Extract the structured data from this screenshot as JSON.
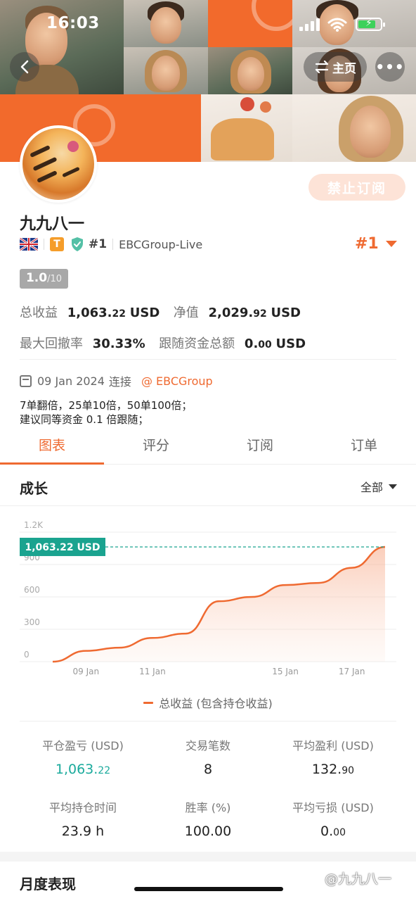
{
  "status_bar": {
    "time": "16:03"
  },
  "nav": {
    "home_label": "主页",
    "more_label": "•••"
  },
  "profile": {
    "name": "九九八一",
    "subscribe_label": "禁止订阅",
    "badge_letter": "T",
    "rank_small": "#1",
    "broker": "EBCGroup-Live",
    "rank_big": "#1",
    "score_main": "1.0",
    "score_total": "/10"
  },
  "metrics": {
    "total_profit_label": "总收益",
    "total_profit_int": "1,063.",
    "total_profit_dec": "22",
    "total_profit_cur": "USD",
    "equity_label": "净值",
    "equity_int": "2,029.",
    "equity_dec": "92",
    "equity_cur": "USD",
    "drawdown_label": "最大回撤率",
    "drawdown_value": "30.33%",
    "follow_label": "跟随资金总额",
    "follow_int": "0.",
    "follow_dec": "00",
    "follow_cur": "USD"
  },
  "join": {
    "date": "09 Jan 2024",
    "connect_label": "连接",
    "broker_link": "@ EBCGroup"
  },
  "description": {
    "line1": "7单翻倍，25单10倍，50单100倍；",
    "line2": "建议同等资金 0.1 倍跟随；"
  },
  "tabs": [
    "图表",
    "评分",
    "订阅",
    "订单"
  ],
  "growth": {
    "title": "成长",
    "range": "全部"
  },
  "chart_data": {
    "type": "area",
    "title": "",
    "x": [
      "08 Jan",
      "09 Jan",
      "10 Jan",
      "11 Jan",
      "12 Jan",
      "13 Jan",
      "14 Jan",
      "15 Jan",
      "16 Jan",
      "17 Jan",
      "18 Jan"
    ],
    "x_tick_labels": [
      "09 Jan",
      "11 Jan",
      "15 Jan",
      "17 Jan"
    ],
    "y_tick_labels": [
      "0",
      "300",
      "600",
      "900",
      "1.2K"
    ],
    "ylim": [
      0,
      1200
    ],
    "series": [
      {
        "name": "总收益 (包含持仓收益)",
        "values": [
          0,
          100,
          130,
          220,
          260,
          560,
          600,
          710,
          730,
          870,
          1063.22
        ]
      }
    ],
    "current_value_label": "1,063.22 USD",
    "line_color": "#ef6a31",
    "marker_color": "#1aa38f",
    "grid": true,
    "legend_position": "bottom"
  },
  "stats": [
    {
      "label": "平仓盈亏 (USD)",
      "int": "1,063.",
      "dec": "22",
      "teal": true
    },
    {
      "label": "交易笔数",
      "int": "8",
      "dec": "",
      "teal": false
    },
    {
      "label": "平均盈利 (USD)",
      "int": "132.",
      "dec": "90",
      "teal": false
    },
    {
      "label": "平均持仓时间",
      "int": "23.9 h",
      "dec": "",
      "teal": false
    },
    {
      "label": "胜率 (%)",
      "int": "100.00",
      "dec": "",
      "teal": false
    },
    {
      "label": "平均亏损 (USD)",
      "int": "0.",
      "dec": "00",
      "teal": false
    }
  ],
  "monthly": {
    "title": "月度表现"
  },
  "watermark": "@九九八一",
  "colors": {
    "accent": "#ef6a31",
    "teal": "#1aaa9c",
    "banner": "#f26a2c"
  }
}
